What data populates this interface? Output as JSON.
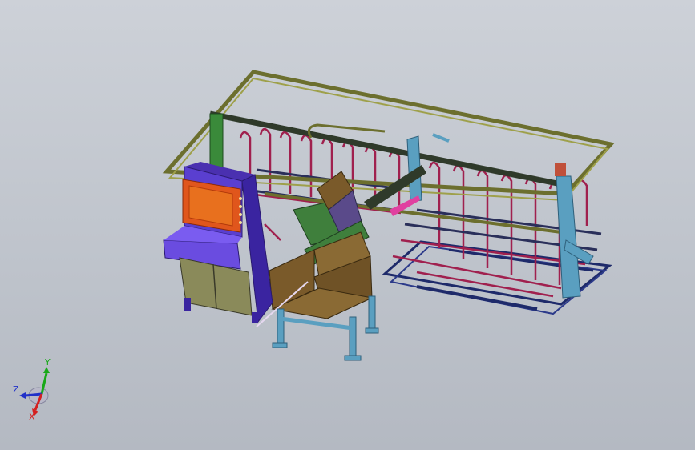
{
  "viewport": {
    "background_top": "#cdd1d8",
    "background_bottom": "#b4b9c2"
  },
  "model": {
    "components": [
      "overhead-gantry-frame",
      "storage-rack-rows",
      "control-cabinet",
      "hmi-screen",
      "feeder-hopper-station",
      "gantry-carriage-arm"
    ],
    "colors": {
      "gantry_frame": "#6c6f2e",
      "rack": "#a0204e",
      "cabinet_purple": "#5a3fd0",
      "cabinet_base": "#8a8a5a",
      "hmi_screen": "#e0561c",
      "hopper_brown": "#7a5a2a",
      "hopper_green": "#3f7f3c",
      "support_blue": "#5a9fc0",
      "base_rail": "#1e2a6a"
    }
  },
  "triad": {
    "x_label": "X",
    "y_label": "Y",
    "z_label": "Z",
    "x_color": "#d42020",
    "y_color": "#18a818",
    "z_color": "#2030c8"
  }
}
